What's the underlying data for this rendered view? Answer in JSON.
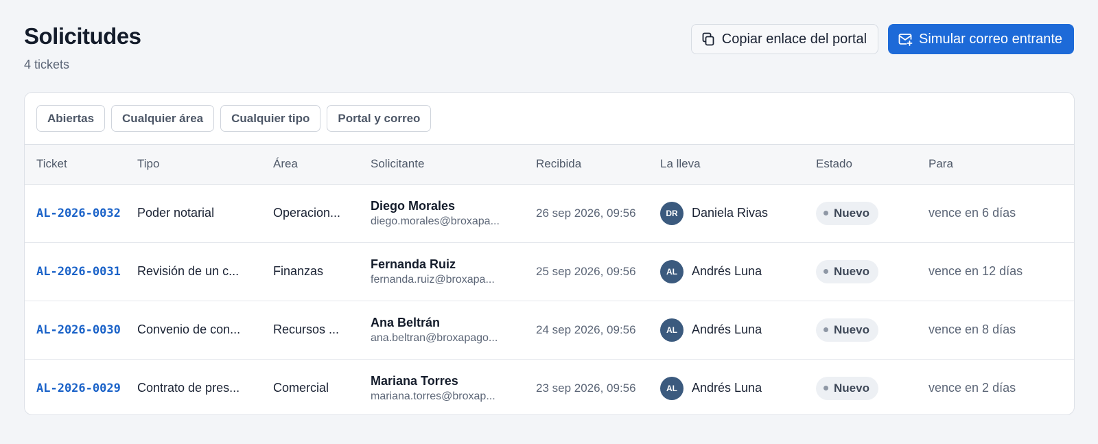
{
  "header": {
    "title": "Solicitudes",
    "subtitle": "4 tickets",
    "copy_link_label": "Copiar enlace del portal",
    "simulate_email_label": "Simular correo entrante"
  },
  "filters": [
    "Abiertas",
    "Cualquier área",
    "Cualquier tipo",
    "Portal y correo"
  ],
  "table": {
    "columns": [
      "Ticket",
      "Tipo",
      "Área",
      "Solicitante",
      "Recibida",
      "La lleva",
      "Estado",
      "Para"
    ],
    "rows": [
      {
        "ticket": "AL-2026-0032",
        "type": "Poder notarial",
        "area": "Operacion...",
        "requester_name": "Diego Morales",
        "requester_email": "diego.morales@broxapa...",
        "received": "26 sep 2026, 09:56",
        "owner_initials": "DR",
        "owner_name": "Daniela Rivas",
        "status": "Nuevo",
        "due": "vence en 6 días"
      },
      {
        "ticket": "AL-2026-0031",
        "type": "Revisión de un c...",
        "area": "Finanzas",
        "requester_name": "Fernanda Ruiz",
        "requester_email": "fernanda.ruiz@broxapa...",
        "received": "25 sep 2026, 09:56",
        "owner_initials": "AL",
        "owner_name": "Andrés Luna",
        "status": "Nuevo",
        "due": "vence en 12 días"
      },
      {
        "ticket": "AL-2026-0030",
        "type": "Convenio de con...",
        "area": "Recursos ...",
        "requester_name": "Ana Beltrán",
        "requester_email": "ana.beltran@broxapago...",
        "received": "24 sep 2026, 09:56",
        "owner_initials": "AL",
        "owner_name": "Andrés Luna",
        "status": "Nuevo",
        "due": "vence en 8 días"
      },
      {
        "ticket": "AL-2026-0029",
        "type": "Contrato de pres...",
        "area": "Comercial",
        "requester_name": "Mariana Torres",
        "requester_email": "mariana.torres@broxap...",
        "received": "23 sep 2026, 09:56",
        "owner_initials": "AL",
        "owner_name": "Andrés Luna",
        "status": "Nuevo",
        "due": "vence en 2 días"
      }
    ]
  },
  "icons": {
    "copy_button": "copy-icon",
    "simulate_button": "mail-plus-icon"
  },
  "colors": {
    "accent": "#1d6ad8",
    "ticket_link": "#1a62c8",
    "avatar": "#3b5a7e",
    "badge_bg": "#edf0f4",
    "page_bg": "#f3f5f8"
  }
}
